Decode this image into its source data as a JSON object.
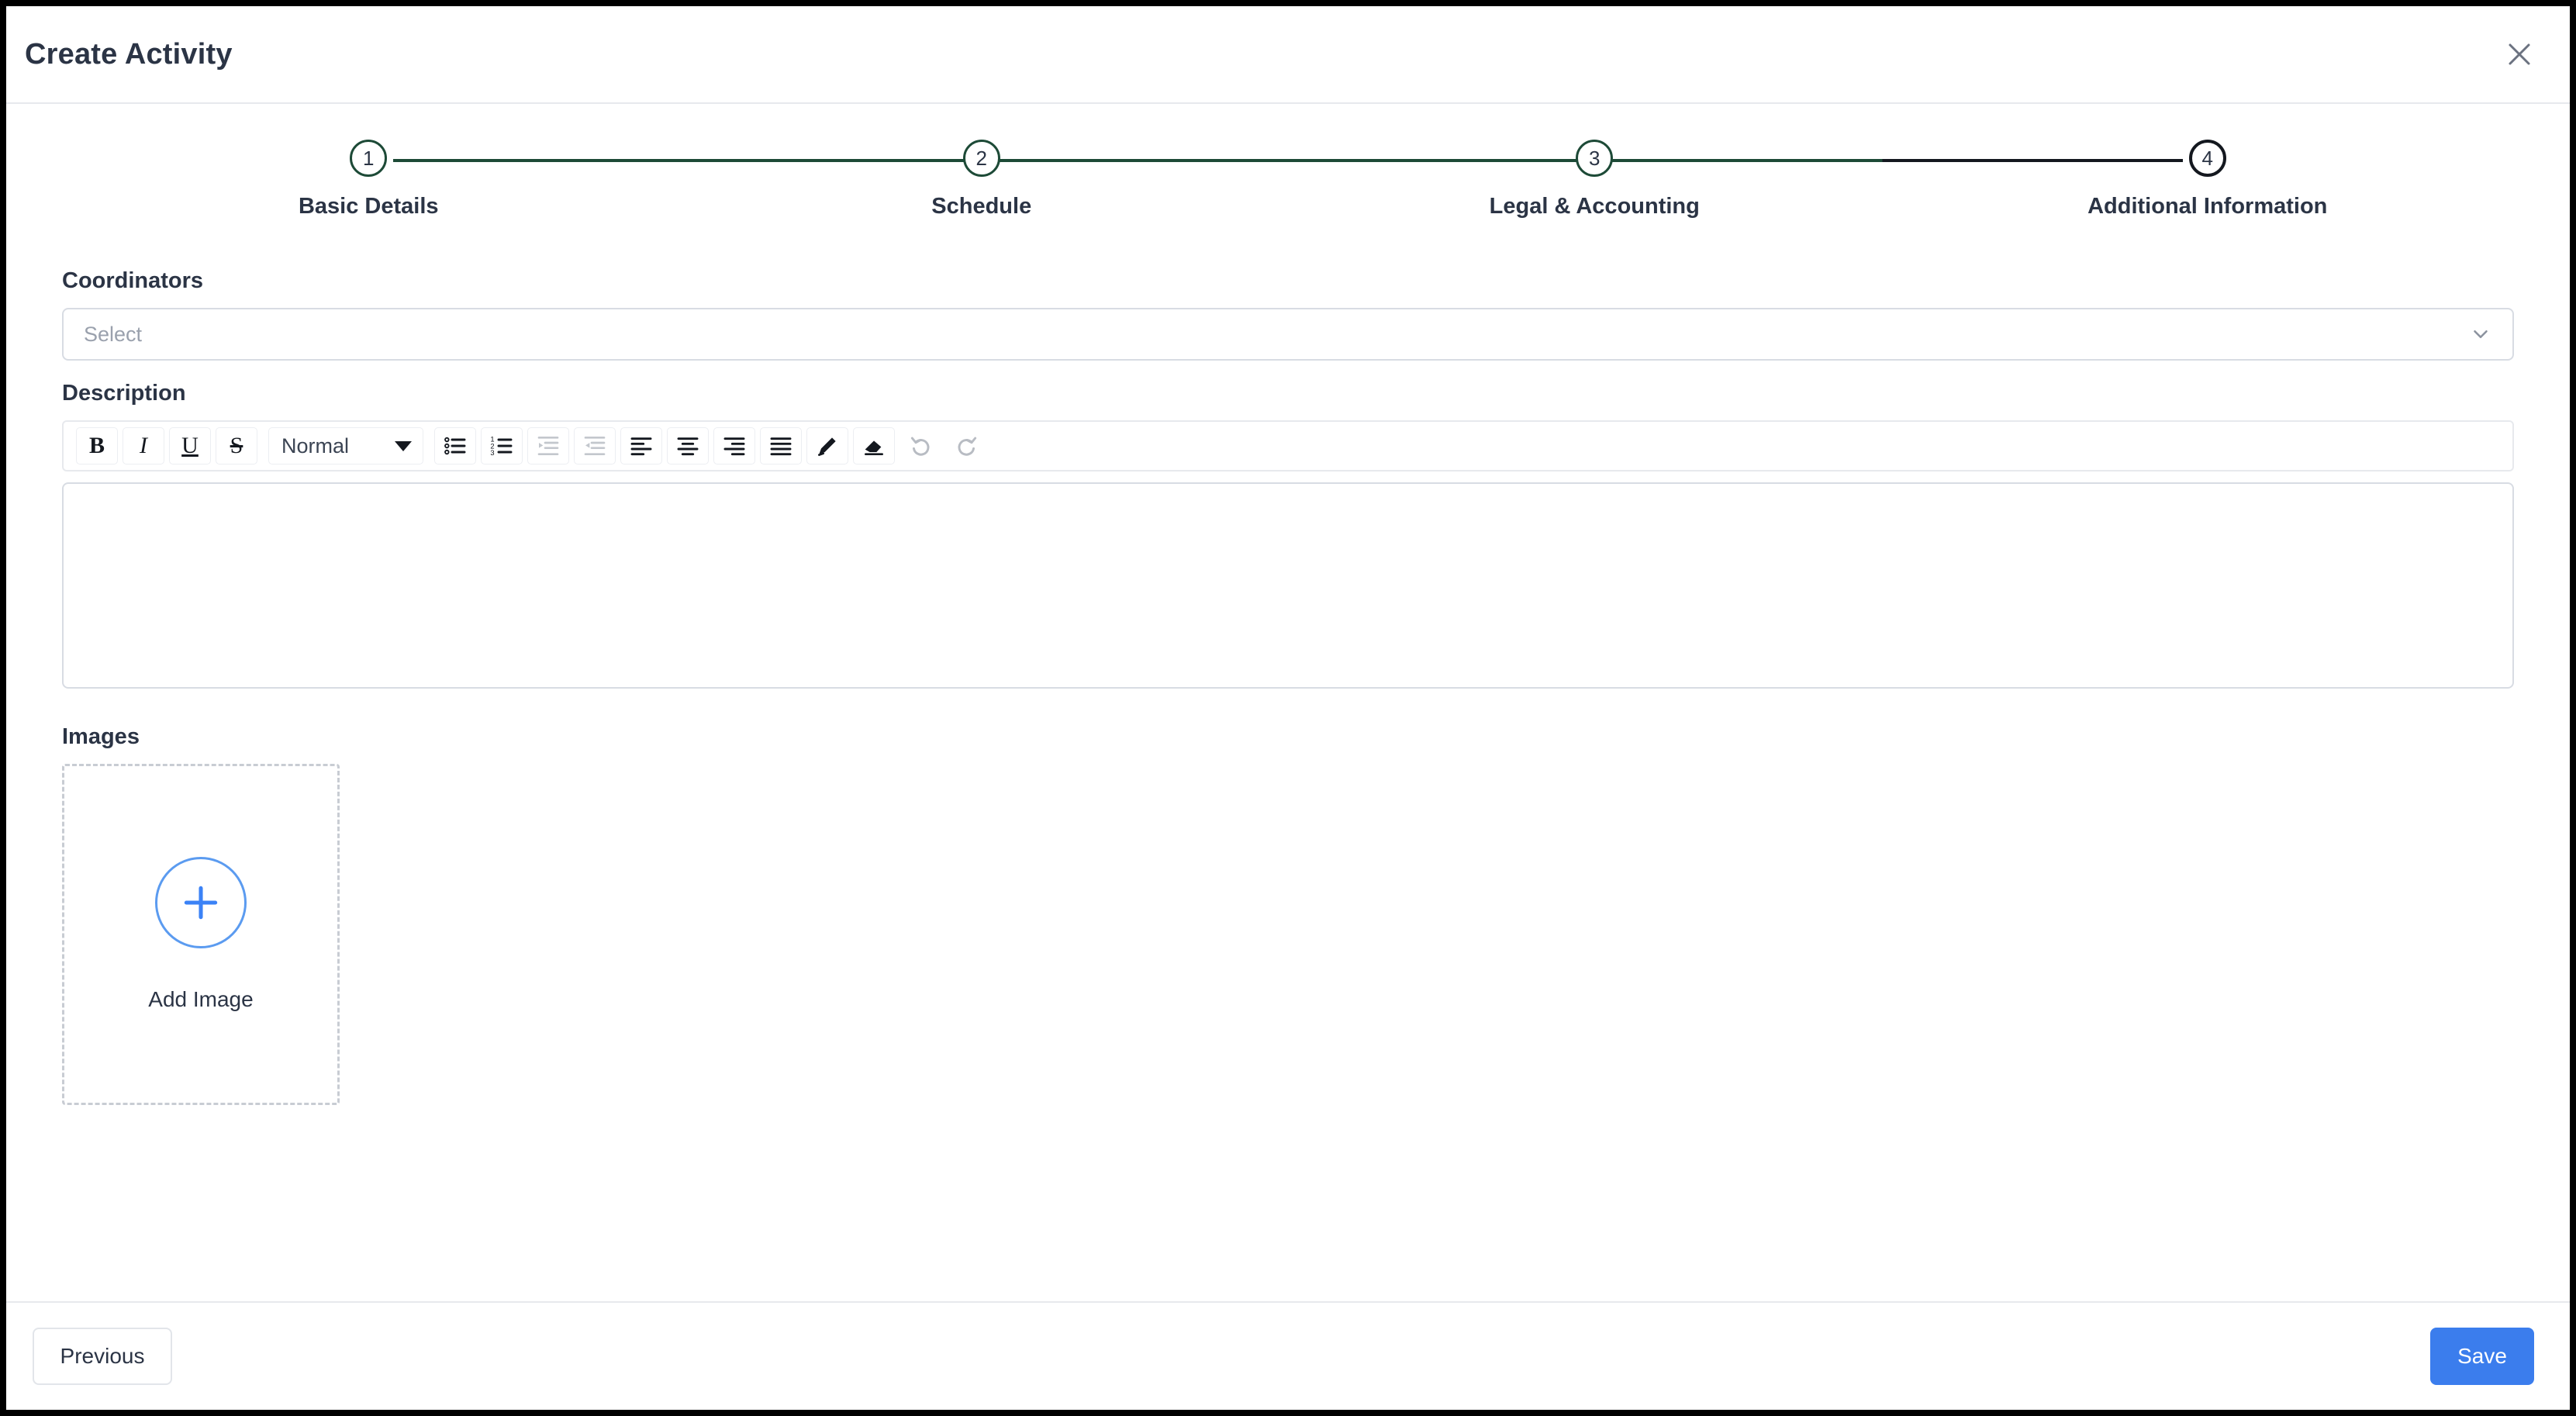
{
  "header": {
    "title": "Create Activity",
    "close_icon": "close-icon"
  },
  "stepper": {
    "current_step": 4,
    "steps": [
      {
        "number": "1",
        "label": "Basic Details",
        "state": "done"
      },
      {
        "number": "2",
        "label": "Schedule",
        "state": "done"
      },
      {
        "number": "3",
        "label": "Legal & Accounting",
        "state": "done"
      },
      {
        "number": "4",
        "label": "Additional Information",
        "state": "current"
      }
    ],
    "colors": {
      "done": "#1d4a37",
      "current": "#14181f"
    }
  },
  "coordinators": {
    "label": "Coordinators",
    "placeholder": "Select",
    "value": "",
    "chevron_icon": "chevron-down-icon"
  },
  "description": {
    "label": "Description",
    "value": "",
    "toolbar": {
      "bold": {
        "glyph": "B",
        "name": "bold-icon",
        "disabled": false
      },
      "italic": {
        "glyph": "I",
        "name": "italic-icon",
        "disabled": false
      },
      "underline": {
        "glyph": "U",
        "name": "underline-icon",
        "disabled": false
      },
      "strike": {
        "glyph": "S",
        "name": "strikethrough-icon",
        "disabled": false
      },
      "format_select": {
        "value": "Normal",
        "name": "text-format-select"
      },
      "bullet_list": {
        "name": "bullet-list-icon",
        "disabled": false
      },
      "numbered_list": {
        "name": "numbered-list-icon",
        "disabled": false
      },
      "indent": {
        "name": "indent-increase-icon",
        "disabled": true
      },
      "outdent": {
        "name": "indent-decrease-icon",
        "disabled": true
      },
      "align_left": {
        "name": "align-left-icon",
        "disabled": false
      },
      "align_center": {
        "name": "align-center-icon",
        "disabled": false
      },
      "align_right": {
        "name": "align-right-icon",
        "disabled": false
      },
      "align_justify": {
        "name": "align-justify-icon",
        "disabled": false
      },
      "pen": {
        "name": "pen-icon",
        "disabled": false
      },
      "eraser": {
        "name": "eraser-icon",
        "disabled": false
      },
      "undo": {
        "name": "undo-icon",
        "disabled": true
      },
      "redo": {
        "name": "redo-icon",
        "disabled": true
      }
    }
  },
  "images": {
    "label": "Images",
    "add_label": "Add Image",
    "plus_icon": "plus-icon",
    "accent": "#5b9bf0"
  },
  "footer": {
    "previous_label": "Previous",
    "save_label": "Save",
    "save_color": "#3b7ded"
  }
}
